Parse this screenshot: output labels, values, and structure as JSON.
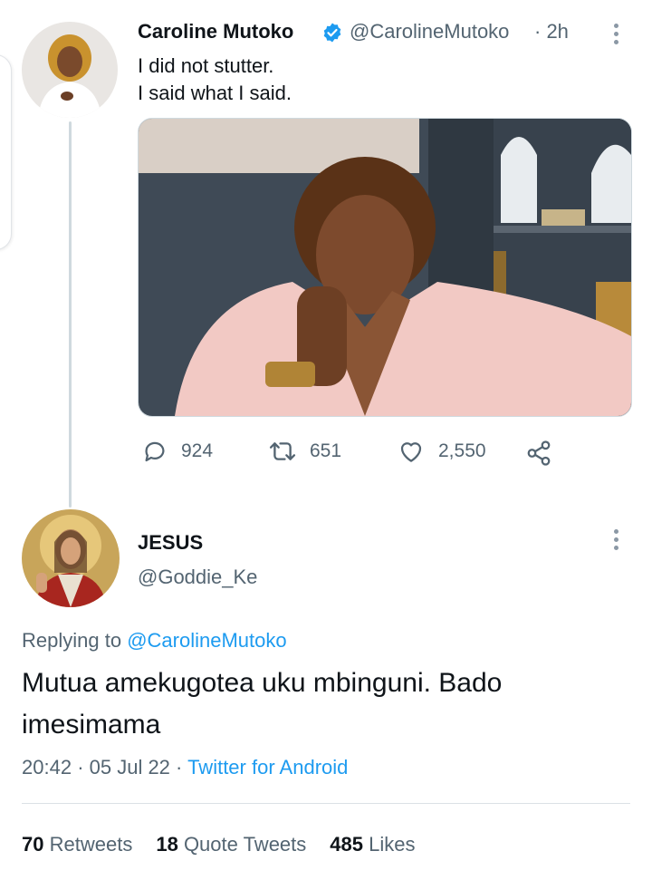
{
  "tweet": {
    "author_name": "Caroline Mutoko",
    "author_handle": "@CarolineMutoko",
    "time": "· 2h",
    "text_line1": "I did not stutter.",
    "text_line2": "I said what I said.",
    "actions": {
      "replies": "924",
      "retweets": "651",
      "likes": "2,550"
    }
  },
  "reply": {
    "author_name": "JESUS",
    "author_handle": "@Goddie_Ke",
    "replying_to_prefix": "Replying to",
    "replying_to_handle": "@CarolineMutoko",
    "text_line1": "Mutua amekugotea uku mbinguni. Bado",
    "text_line2": "imesimama",
    "time": "20:42",
    "date": "· 05 Jul 22 ·",
    "source": "Twitter for Android",
    "stats": {
      "retweets_count": "70",
      "retweets_label": "Retweets",
      "quotes_count": "18",
      "quotes_label": "Quote Tweets",
      "likes_count": "485",
      "likes_label": "Likes"
    }
  },
  "colors": {
    "accent": "#1d9bf0",
    "verified": "#1d9bf0",
    "muted_text": "#536471"
  },
  "icons": [
    "verified-badge-icon",
    "more-icon",
    "reply-icon",
    "retweet-icon",
    "like-icon",
    "share-icon"
  ]
}
